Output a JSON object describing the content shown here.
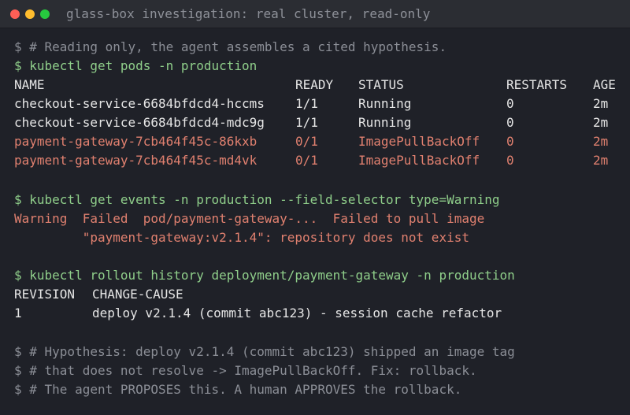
{
  "window": {
    "title": "glass-box investigation: real cluster, read-only"
  },
  "terminal": {
    "intro_comment": "$ # Reading only, the agent assembles a cited hypothesis.",
    "cmd_get_pods": "$ kubectl get pods -n production",
    "pods_table": {
      "headers": [
        "NAME",
        "READY",
        "STATUS",
        "RESTARTS",
        "AGE"
      ],
      "rows": [
        {
          "name": "checkout-service-6684bfdcd4-hccms",
          "ready": "1/1",
          "status": "Running",
          "restarts": "0",
          "age": "2m",
          "state": "ok"
        },
        {
          "name": "checkout-service-6684bfdcd4-mdc9g",
          "ready": "1/1",
          "status": "Running",
          "restarts": "0",
          "age": "2m",
          "state": "ok"
        },
        {
          "name": "payment-gateway-7cb464f45c-86kxb",
          "ready": "0/1",
          "status": "ImagePullBackOff",
          "restarts": "0",
          "age": "2m",
          "state": "error"
        },
        {
          "name": "payment-gateway-7cb464f45c-md4vk",
          "ready": "0/1",
          "status": "ImagePullBackOff",
          "restarts": "0",
          "age": "2m",
          "state": "error"
        }
      ]
    },
    "cmd_get_events": "$ kubectl get events -n production --field-selector type=Warning",
    "events_output": [
      "Warning  Failed  pod/payment-gateway-...  Failed to pull image",
      "         \"payment-gateway:v2.1.4\": repository does not exist"
    ],
    "cmd_rollout_history": "$ kubectl rollout history deployment/payment-gateway -n production",
    "rollout_table": {
      "headers": [
        "REVISION",
        "CHANGE-CAUSE"
      ],
      "rows": [
        {
          "revision": "1",
          "change_cause": "deploy v2.1.4 (commit abc123) - session cache refactor"
        }
      ]
    },
    "hypothesis_comments": [
      "$ # Hypothesis: deploy v2.1.4 (commit abc123) shipped an image tag",
      "$ # that does not resolve -> ImagePullBackOff. Fix: rollback.",
      "$ # The agent PROPOSES this. A human APPROVES the rollback."
    ]
  },
  "colors": {
    "background": "#1f2128",
    "titlebar": "#2b2d33",
    "command": "#8fce8a",
    "comment": "#8b8e96",
    "error": "#e0806f",
    "text": "#e6e6e6"
  }
}
